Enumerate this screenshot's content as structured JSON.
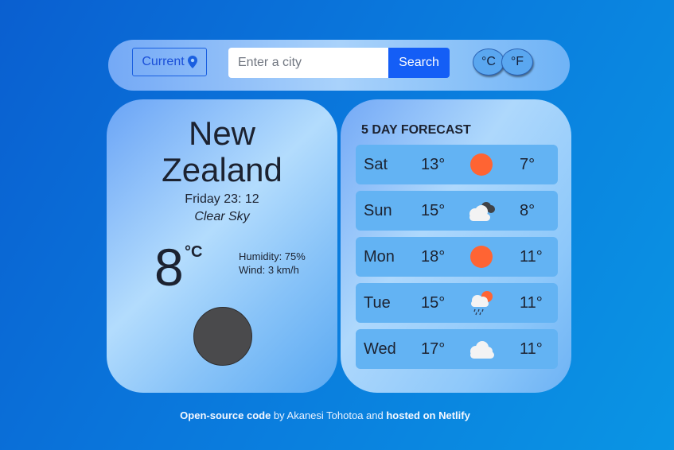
{
  "header": {
    "current_label": "Current",
    "search_placeholder": "Enter a city",
    "search_label": "Search",
    "unit_c": "°C",
    "unit_f": "°F"
  },
  "current": {
    "city_line1": "New",
    "city_line2": "Zealand",
    "datetime": "Friday 23: 12",
    "description": "Clear Sky",
    "temperature": "8",
    "temp_unit": "°C",
    "humidity": "Humidity: 75%",
    "wind": "Wind: 3 km/h",
    "icon": "moon-icon"
  },
  "forecast": {
    "title": "5 DAY FORECAST",
    "days": [
      {
        "day": "Sat",
        "max": "13°",
        "min": "7°",
        "icon": "sun-icon"
      },
      {
        "day": "Sun",
        "max": "15°",
        "min": "8°",
        "icon": "cloudy-icon"
      },
      {
        "day": "Mon",
        "max": "18°",
        "min": "11°",
        "icon": "sun-icon"
      },
      {
        "day": "Tue",
        "max": "15°",
        "min": "11°",
        "icon": "rain-sun-icon"
      },
      {
        "day": "Wed",
        "max": "17°",
        "min": "11°",
        "icon": "cloud-icon"
      }
    ]
  },
  "footer": {
    "link1": "Open-source code",
    "text1": " by Akanesi Tohotoa and ",
    "link2": "hosted on Netlify"
  },
  "colors": {
    "accent": "#145ef6",
    "sun": "#ff6433",
    "row_bg": "#63b3f3"
  }
}
